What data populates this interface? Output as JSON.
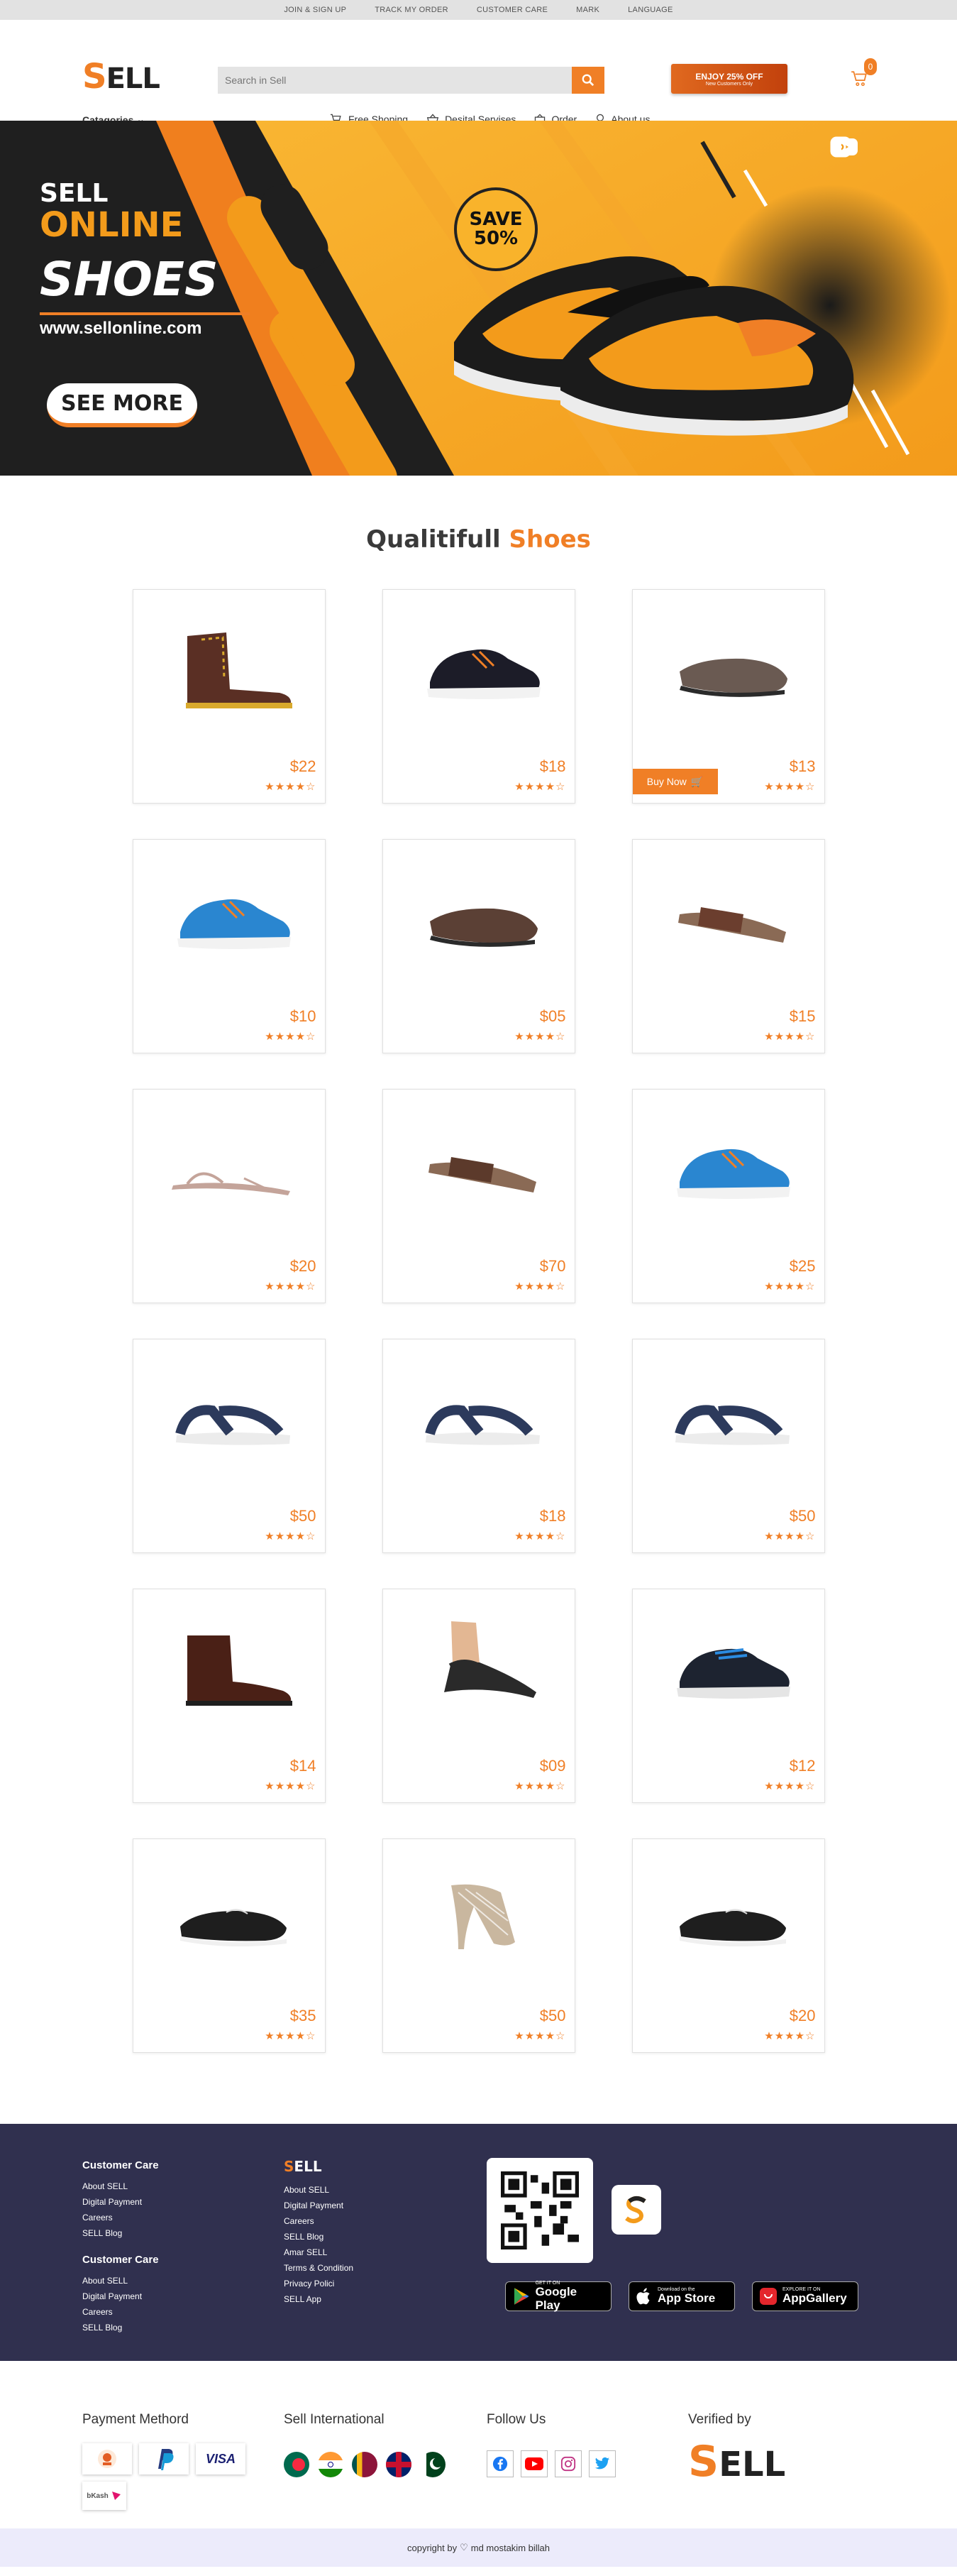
{
  "topbar": [
    "JOIN & SIGN UP",
    "TRACK MY ORDER",
    "CUSTOMER CARE",
    "MARK",
    "LANGUAGE"
  ],
  "logo": {
    "first": "S",
    "rest": "ELL"
  },
  "categories_label": "Catagories",
  "search": {
    "placeholder": "Search in Sell"
  },
  "promo": {
    "title": "ENJOY 25% OFF",
    "subtitle": "New Customers Only"
  },
  "cart": {
    "count": "0"
  },
  "nav": [
    "Free Shoping",
    "Desital Servises",
    "Order",
    "About us"
  ],
  "hero": {
    "sell": "SELL",
    "online": "ONLINE",
    "shoes": "SHOES",
    "site": "www.sellonline.com",
    "cta": "SEE MORE",
    "save_line1": "SAVE",
    "save_line2": "50%"
  },
  "section": {
    "title": "Qualitifull",
    "highlight": "Shoes"
  },
  "buy_label": "Buy Now",
  "stars": "★★★★☆",
  "products": [
    {
      "price": "$22",
      "icon": "boot-icon",
      "kind": "boot-brown",
      "color": "#5a2f24"
    },
    {
      "price": "$18",
      "icon": "sneaker-icon",
      "kind": "sneaker",
      "color": "#1c1c28"
    },
    {
      "price": "$13",
      "icon": "loafer-icon",
      "kind": "loafer",
      "color": "#6a5a52"
    },
    {
      "price": "$10",
      "icon": "sneaker-icon",
      "kind": "sneaker",
      "color": "#2a86d0"
    },
    {
      "price": "$05",
      "icon": "loafer-icon",
      "kind": "loafer",
      "color": "#5b4035"
    },
    {
      "price": "$15",
      "icon": "slide-icon",
      "kind": "slide",
      "color": "#6b3e2e"
    },
    {
      "price": "$20",
      "icon": "sandal-icon",
      "kind": "flat-sandal",
      "color": "#c4a49a"
    },
    {
      "price": "$70",
      "icon": "slide-icon",
      "kind": "slide",
      "color": "#5c3a2b"
    },
    {
      "price": "$25",
      "icon": "sneaker-icon",
      "kind": "sneaker",
      "color": "#2a86d0"
    },
    {
      "price": "$50",
      "icon": "sandal-icon",
      "kind": "sport-sandal",
      "color": "#2c3a5c"
    },
    {
      "price": "$18",
      "icon": "sandal-icon",
      "kind": "sport-sandal",
      "color": "#2c3a5c"
    },
    {
      "price": "$50",
      "icon": "sandal-icon",
      "kind": "sport-sandal",
      "color": "#2c3a5c"
    },
    {
      "price": "$14",
      "icon": "boot-icon",
      "kind": "chelsea",
      "color": "#4a2016"
    },
    {
      "price": "$09",
      "icon": "sandal-icon",
      "kind": "worn-sandal",
      "color": "#2a2a2a"
    },
    {
      "price": "$12",
      "icon": "sneaker-icon",
      "kind": "sneaker-blue",
      "color": "#1d2330"
    },
    {
      "price": "$35",
      "icon": "loafer-icon",
      "kind": "dress",
      "color": "#1e1e1e"
    },
    {
      "price": "$50",
      "icon": "heel-icon",
      "kind": "heel",
      "color": "#c9b79f"
    },
    {
      "price": "$20",
      "icon": "loafer-icon",
      "kind": "dress",
      "color": "#1e1e1e"
    }
  ],
  "footer": {
    "col1": {
      "title": "Customer Care",
      "links": [
        "About SELL",
        "Digital Payment",
        "Careers",
        "SELL Blog"
      ]
    },
    "col2": {
      "title": "Customer Care",
      "links": [
        "About SELL",
        "Digital Payment",
        "Careers",
        "SELL Blog"
      ]
    },
    "col3": {
      "title_first": "S",
      "title_rest": "ELL",
      "links": [
        "About SELL",
        "Digital Payment",
        "Careers",
        "SELL Blog",
        "Amar SELL",
        "Terms & Condition",
        "Privacy Polici",
        "SELL App"
      ]
    },
    "stores": [
      {
        "small": "GET IT ON",
        "big": "Google Play"
      },
      {
        "small": "Download on the",
        "big": "App Store"
      },
      {
        "small": "EXPLORE IT ON",
        "big": "AppGallery"
      }
    ]
  },
  "bottom": {
    "payment_title": "Payment Methord",
    "payment": [
      "PayPal",
      "VISA",
      "bKash"
    ],
    "international_title": "Sell International",
    "follow_title": "Follow Us",
    "verified_title": "Verified by"
  },
  "copyright": {
    "before": "copyright by",
    "after": "md mostakim billah"
  }
}
